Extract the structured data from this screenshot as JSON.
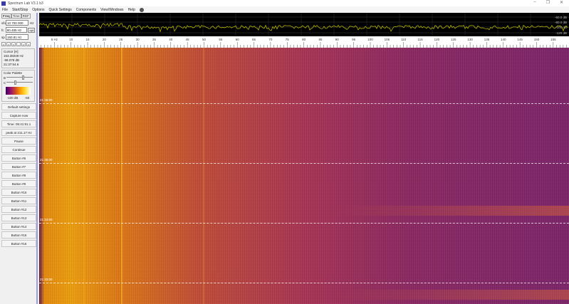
{
  "window": {
    "title": "Spectrum Lab V3.1 b3",
    "min": "–",
    "max": "❐",
    "close": "✕"
  },
  "menu": [
    "File",
    "Start/Stop",
    "Options",
    "Quick Settings",
    "Components",
    "View/Windows",
    "Help"
  ],
  "left": {
    "tabs": [
      "Freq",
      "Time",
      "RDF"
    ],
    "vfo_label": "vfo",
    "vfo_value": "10 700 000",
    "vfo_unit": "Hz",
    "fc_label": "fc",
    "fc_value": "80.485 Hz",
    "fc_button": "opt",
    "sp_label": "sp",
    "sp_value": "160.81 Hz",
    "arrows": [
      "<",
      "<",
      "<",
      "-",
      ">",
      ">"
    ],
    "cursor": {
      "title": "Cursor [H]",
      "freq": "153.35049 Hz",
      "level": "-98.078 dB",
      "time": "21:37:54.6"
    },
    "palette": {
      "title": "Color Palette",
      "b_label": "B",
      "c_label": "C",
      "min": "-100 dB",
      "max": "-50"
    },
    "buttons": [
      "Default settings",
      "Capture now",
      "Time:  05:41:91.1",
      "peak at 211.17 Hz",
      "Pause",
      "Continue",
      "Button #6",
      "Button #7",
      "Button #8",
      "Button #9",
      "Button #10",
      "Button #11",
      "Button #12",
      "Button #13",
      "Button #14",
      "Button #15",
      "Button #16"
    ]
  },
  "spectrum": {
    "db_labels": [
      "-60.0 dB",
      "-80.0 dB",
      "-100 dB",
      "-120 dB"
    ],
    "trace_color": "#c8c800"
  },
  "ruler": {
    "labels": [
      "5 Hz",
      "10",
      "15",
      "20",
      "25",
      "30",
      "35",
      "40",
      "45",
      "50",
      "55",
      "60",
      "65",
      "70",
      "75",
      "80",
      "85",
      "90",
      "95",
      "100",
      "105",
      "110",
      "115",
      "120",
      "125",
      "130",
      "135",
      "140",
      "145",
      "150",
      "155"
    ]
  },
  "waterfall": {
    "time_labels": [
      "21:36:00",
      "21:35:00",
      "21:34:00",
      "21:33:00"
    ]
  }
}
